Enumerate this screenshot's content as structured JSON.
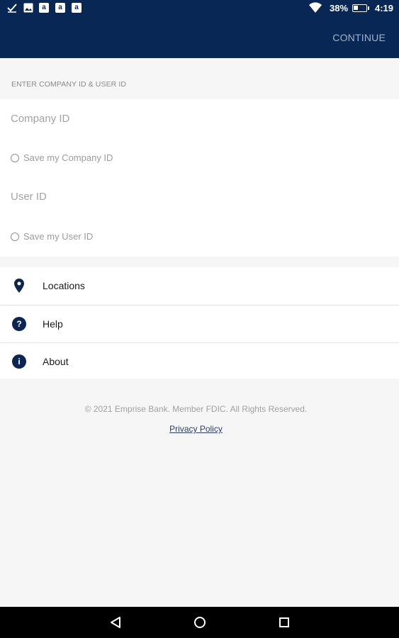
{
  "status_bar": {
    "notif_a": "a",
    "battery_percent": "38%",
    "battery_level": 0.38,
    "time": "4:19"
  },
  "app_bar": {
    "continue_label": "CONTINUE"
  },
  "form": {
    "section_header": "ENTER COMPANY ID & USER ID",
    "company_id_placeholder": "Company ID",
    "save_company_label": "Save my Company ID",
    "user_id_placeholder": "User ID",
    "save_user_label": "Save my User ID"
  },
  "menu": {
    "items": [
      {
        "label": "Locations",
        "icon": "location-pin-icon"
      },
      {
        "label": "Help",
        "icon": "help-icon",
        "glyph": "?"
      },
      {
        "label": "About",
        "icon": "info-icon",
        "glyph": "i"
      }
    ]
  },
  "footer": {
    "copyright": "© 2021 Emprise Bank. Member FDIC. All Rights Reserved.",
    "privacy_link": "Privacy Policy"
  },
  "colors": {
    "primary": "#092754",
    "icon": "#0d2553",
    "background": "#f6f6f6"
  }
}
